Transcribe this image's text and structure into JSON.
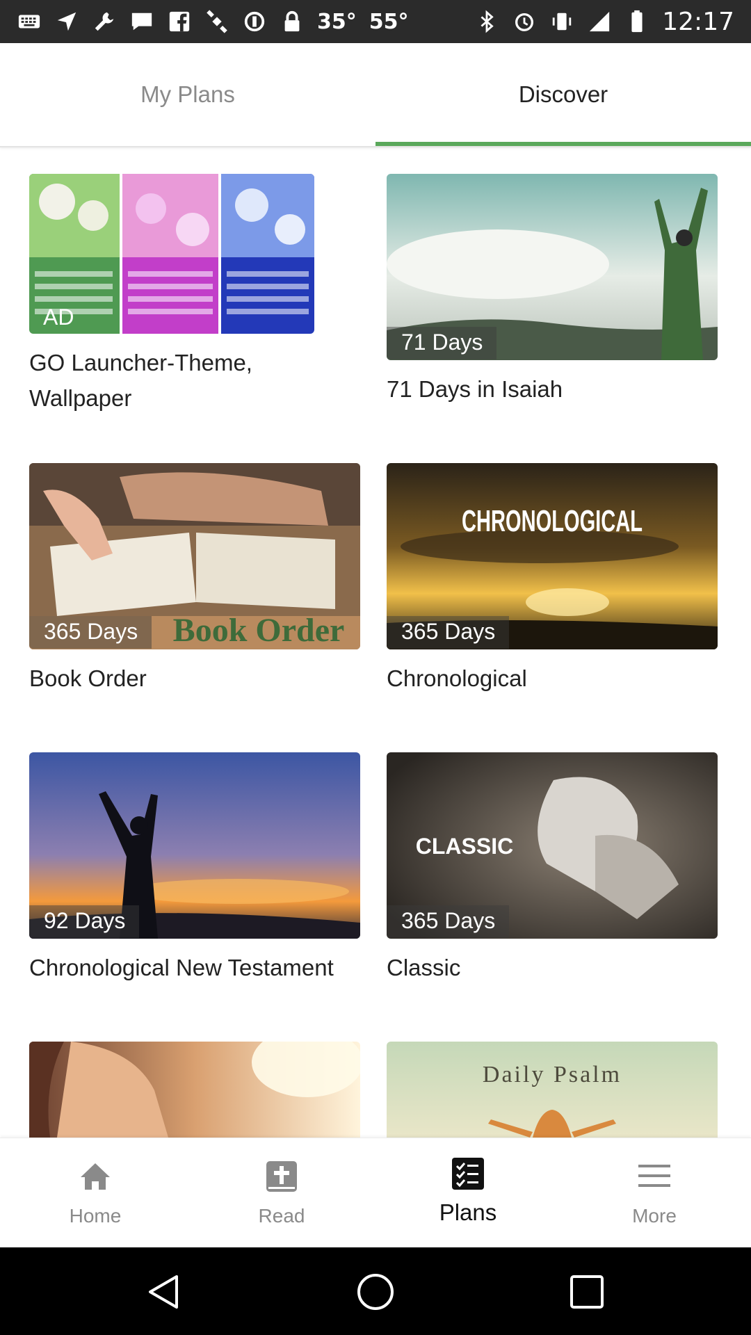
{
  "status_bar": {
    "temp_1": "35°",
    "temp_2": "55°",
    "time": "12:17",
    "icons_left": [
      "keyboard-icon",
      "navigation-icon",
      "wrench-icon",
      "message-icon",
      "facebook-icon",
      "satellite-icon",
      "sync-icon",
      "lock-icon"
    ],
    "icons_right": [
      "bluetooth-icon",
      "alarm-icon",
      "vibrate-icon",
      "signal-icon",
      "battery-icon"
    ]
  },
  "tabs": [
    {
      "label": "My Plans",
      "active": false
    },
    {
      "label": "Discover",
      "active": true
    }
  ],
  "accent_color": "#5aa85b",
  "cards": [
    {
      "title": "GO Launcher-Theme, Wallpaper",
      "badge": "AD"
    },
    {
      "title": "71 Days in Isaiah",
      "badge": "71 Days"
    },
    {
      "title": "Book Order",
      "badge": "365 Days",
      "image_text": "Book Order"
    },
    {
      "title": "Chronological",
      "badge": "365 Days",
      "image_text": "CHRONOLOGICAL"
    },
    {
      "title": "Chronological New Testament",
      "badge": "92 Days"
    },
    {
      "title": "Classic",
      "badge": "365 Days",
      "image_text": "CLASSIC"
    },
    {
      "title": "",
      "badge": ""
    },
    {
      "title": "",
      "badge": "",
      "image_text": "Daily Psalm"
    }
  ],
  "bottom_nav": [
    {
      "label": "Home",
      "icon": "home-icon",
      "active": false
    },
    {
      "label": "Read",
      "icon": "bible-icon",
      "active": false
    },
    {
      "label": "Plans",
      "icon": "checklist-icon",
      "active": true
    },
    {
      "label": "More",
      "icon": "menu-icon",
      "active": false
    }
  ],
  "system_nav": [
    "back-icon",
    "home-circle-icon",
    "recents-icon"
  ]
}
